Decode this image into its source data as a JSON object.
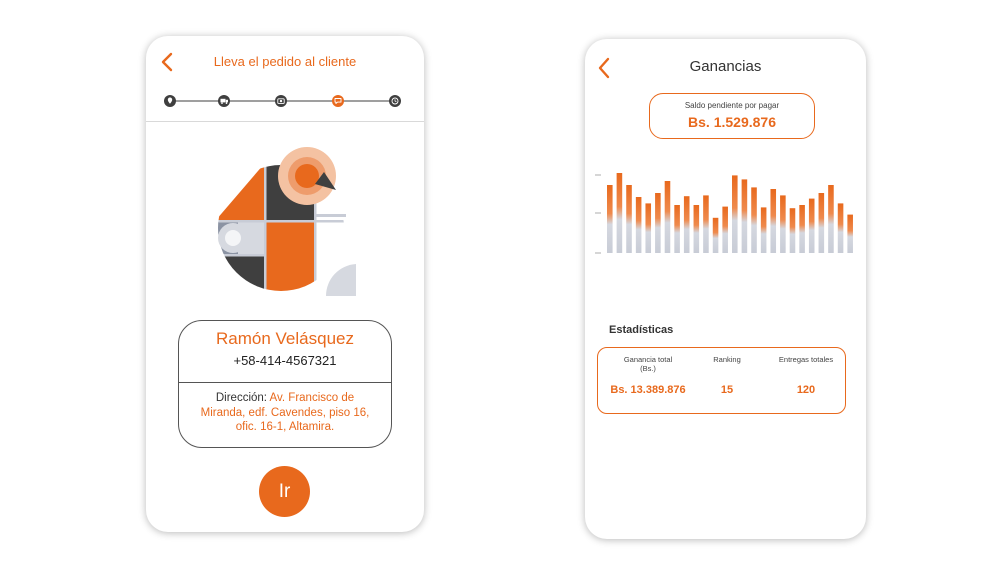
{
  "delivery_screen": {
    "title": "Lleva el pedido al cliente",
    "progress_steps": [
      {
        "icon": "map-pin-icon",
        "state": "done"
      },
      {
        "icon": "truck-icon",
        "state": "done"
      },
      {
        "icon": "camera-icon",
        "state": "done"
      },
      {
        "icon": "chat-icon",
        "state": "current"
      },
      {
        "icon": "clock-icon",
        "state": "pending"
      }
    ],
    "customer": {
      "name": "Ramón Velásquez",
      "phone": "+58-414-4567321",
      "address_label": "Dirección: ",
      "address_value": "Av. Francisco de Miranda, edf. Cavendes, piso 16, ofic. 16-1, Altamira."
    },
    "go_button_label": "Ir"
  },
  "earnings_screen": {
    "title": "Ganancias",
    "balance": {
      "label": "Saldo pendiente por pagar",
      "value": "Bs. 1.529.876"
    },
    "stats_title": "Estadísticas",
    "stats": {
      "total_label": "Ganancia total\n(Bs.)",
      "total_value": "Bs. 13.389.876",
      "ranking_label": "Ranking",
      "ranking_value": "15",
      "deliveries_label": "Entregas totales",
      "deliveries_value": "120"
    }
  },
  "chart_data": {
    "type": "bar",
    "values": [
      0.85,
      1.0,
      0.85,
      0.7,
      0.62,
      0.75,
      0.9,
      0.6,
      0.71,
      0.6,
      0.72,
      0.44,
      0.58,
      0.97,
      0.92,
      0.82,
      0.57,
      0.8,
      0.72,
      0.56,
      0.6,
      0.68,
      0.75,
      0.85,
      0.62,
      0.48
    ],
    "colors": {
      "top": "#e8691d",
      "bottom": "#c8ccd6"
    }
  },
  "colors": {
    "accent": "#e8691d",
    "dark": "#3f3f3f",
    "grey": "#c8ccd6"
  }
}
